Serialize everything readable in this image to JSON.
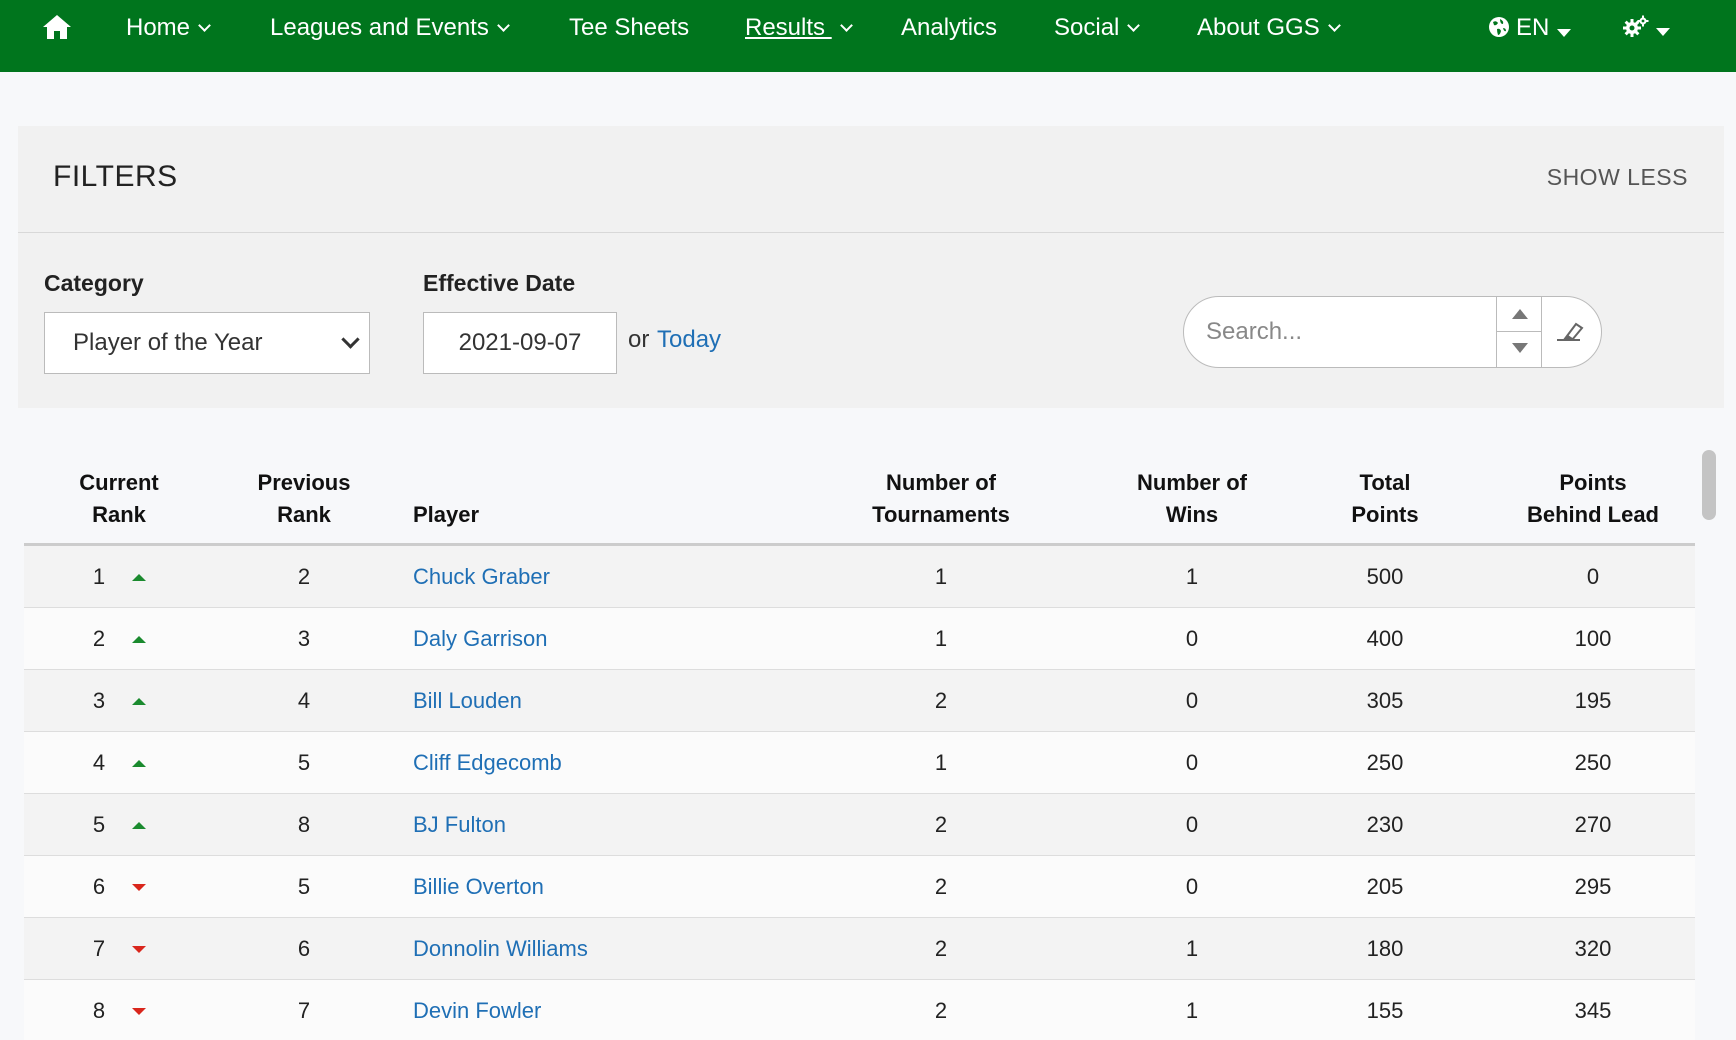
{
  "nav": {
    "home_icon": "home-icon",
    "items": [
      {
        "label": "Home",
        "dropdown": true
      },
      {
        "label": "Leagues and Events",
        "dropdown": true
      },
      {
        "label": "Tee Sheets",
        "dropdown": false
      },
      {
        "label": "Results ",
        "dropdown": true,
        "active": true
      },
      {
        "label": "Analytics",
        "dropdown": false
      },
      {
        "label": "Social",
        "dropdown": true
      },
      {
        "label": "About GGS",
        "dropdown": true
      }
    ],
    "language": "EN",
    "globe_icon": "globe-icon",
    "settings_icon": "gear-icon",
    "background": "#00751d"
  },
  "filters": {
    "title": "FILTERS",
    "show_less": "SHOW LESS",
    "category_label": "Category",
    "category_value": "Player of the Year",
    "date_label": "Effective Date",
    "date_value": "2021-09-07",
    "or_text": "or",
    "today_link": "Today",
    "search_placeholder": "Search...",
    "search_value": ""
  },
  "table": {
    "headers": {
      "current_rank": [
        "Current",
        "Rank"
      ],
      "previous_rank": [
        "Previous",
        "Rank"
      ],
      "player": "Player",
      "tournaments": [
        "Number of",
        "Tournaments"
      ],
      "wins": [
        "Number of",
        "Wins"
      ],
      "total_points": [
        "Total",
        "Points"
      ],
      "points_behind": [
        "Points",
        "Behind Lead"
      ]
    },
    "rows": [
      {
        "rank": "1",
        "trend": "up",
        "prev": "2",
        "player": "Chuck Graber",
        "tournaments": "1",
        "wins": "1",
        "points": "500",
        "behind": "0"
      },
      {
        "rank": "2",
        "trend": "up",
        "prev": "3",
        "player": "Daly Garrison",
        "tournaments": "1",
        "wins": "0",
        "points": "400",
        "behind": "100"
      },
      {
        "rank": "3",
        "trend": "up",
        "prev": "4",
        "player": "Bill Louden",
        "tournaments": "2",
        "wins": "0",
        "points": "305",
        "behind": "195"
      },
      {
        "rank": "4",
        "trend": "up",
        "prev": "5",
        "player": "Cliff Edgecomb",
        "tournaments": "1",
        "wins": "0",
        "points": "250",
        "behind": "250"
      },
      {
        "rank": "5",
        "trend": "up",
        "prev": "8",
        "player": "BJ Fulton",
        "tournaments": "2",
        "wins": "0",
        "points": "230",
        "behind": "270"
      },
      {
        "rank": "6",
        "trend": "down",
        "prev": "5",
        "player": "Billie Overton",
        "tournaments": "2",
        "wins": "0",
        "points": "205",
        "behind": "295"
      },
      {
        "rank": "7",
        "trend": "down",
        "prev": "6",
        "player": "Donnolin Williams",
        "tournaments": "2",
        "wins": "1",
        "points": "180",
        "behind": "320"
      },
      {
        "rank": "8",
        "trend": "down",
        "prev": "7",
        "player": "Devin Fowler",
        "tournaments": "2",
        "wins": "1",
        "points": "155",
        "behind": "345"
      }
    ],
    "trend_colors": {
      "up": "#1a8a2e",
      "down": "#d9261c"
    },
    "link_color": "#1f6fb5"
  }
}
